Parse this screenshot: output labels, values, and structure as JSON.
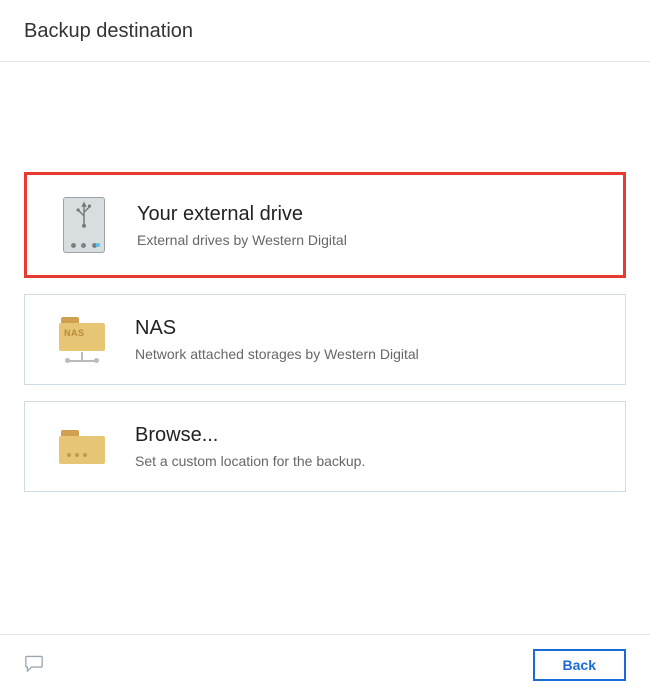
{
  "header": {
    "title": "Backup destination"
  },
  "options": {
    "external_drive": {
      "title": "Your external drive",
      "subtitle": "External drives by Western Digital"
    },
    "nas": {
      "title": "NAS",
      "subtitle": "Network attached storages by Western Digital",
      "folder_label": "NAS"
    },
    "browse": {
      "title": "Browse...",
      "subtitle": "Set a custom location for the backup."
    }
  },
  "footer": {
    "back_label": "Back"
  }
}
